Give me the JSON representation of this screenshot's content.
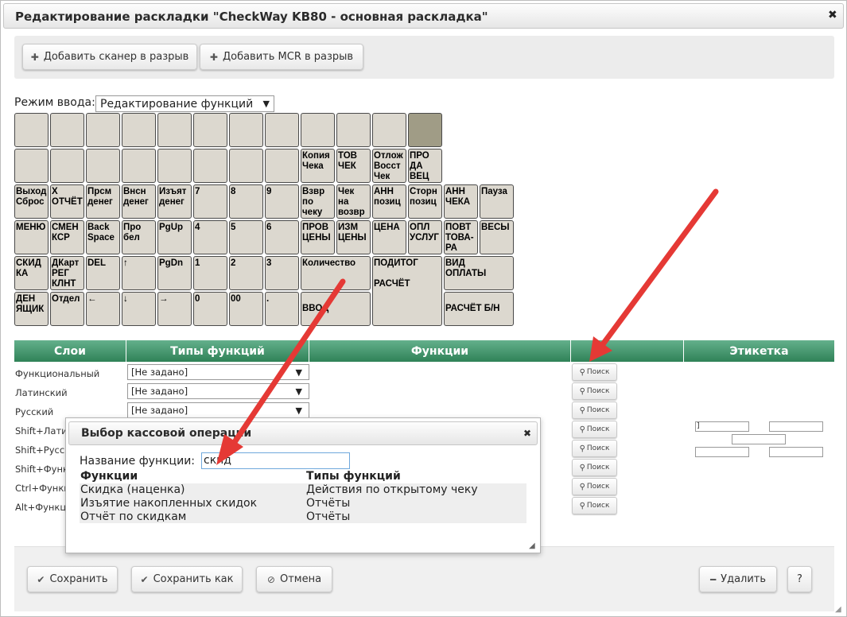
{
  "window": {
    "title": "Редактирование раскладки \"CheckWay KB80 - основная раскладка\""
  },
  "toolbar": {
    "add_scanner": "Добавить сканер в разрыв",
    "add_mcr": "Добавить MCR в разрыв"
  },
  "mode": {
    "label": "Режим ввода:",
    "value": "Редактирование функций"
  },
  "keyboard": {
    "keys": [
      "",
      "",
      "",
      "",
      "",
      "",
      "",
      "",
      "",
      "",
      "",
      "",
      "",
      "",
      "",
      "",
      "",
      "",
      "",
      "",
      "Копия\nЧека",
      "ТОВ\nЧЕК",
      "Отлож\nВосст\nЧек",
      "ПРО\nДА\nВЕЦ",
      "Выход\nСброс",
      "X\nОТЧЁТ",
      "Прсм\nденег",
      "Внсн\nденег",
      "Изъят\nденег",
      "7",
      "8",
      "9",
      "Взвр\nпо\nчеку",
      "Чек\nна\nвозвр",
      "АНН\nпозиц",
      "Сторн\nпозиц",
      "АНН\nЧЕКА",
      "Пауза",
      "МЕНЮ",
      "СМЕН\nКСР",
      "Back\nSpace",
      "Про\nбел",
      "PgUp",
      "4",
      "5",
      "6",
      "ПРОВ\nЦЕНЫ",
      "ИЗМ\nЦЕНЫ",
      "ЦЕНА",
      "ОПЛ\nУСЛУГ",
      "ПОВТ\nТОВА-\nРА",
      "ВЕСЫ",
      "СКИД\nКА",
      "ДКарт\nРЕГ\nКЛНТ",
      "DEL",
      "↑",
      "PgDn",
      "1",
      "2",
      "3",
      "Количество",
      "ПОДИТОГ\n\nРАСЧЁТ",
      "ВИД\nОПЛАТЫ",
      "ДЕН\nЯЩИК",
      "Отдел",
      "←",
      "↓",
      "→",
      "0",
      "00",
      ".",
      "ВВОД",
      "РАСЧЁТ Б/Н"
    ]
  },
  "table": {
    "headers": [
      "Слои",
      "Типы функций",
      "Функции",
      "",
      "Этикетка"
    ],
    "rows": [
      {
        "layer": "Функциональный",
        "type": "[Не задано]"
      },
      {
        "layer": "Латинский",
        "type": "[Не задано]"
      },
      {
        "layer": "Русский",
        "type": "[Не задано]"
      },
      {
        "layer": "Shift+Лати"
      },
      {
        "layer": "Shift+Русс"
      },
      {
        "layer": "Shift+Функ"
      },
      {
        "layer": "Ctrl+Функц"
      },
      {
        "layer": "Alt+Функц"
      }
    ],
    "search_label": "Поиск",
    "label_fields": [
      "]",
      "",
      "",
      "",
      ""
    ]
  },
  "dialog": {
    "title": "Выбор кассовой операции",
    "name_label": "Название функции:",
    "name_value": "скид",
    "col_functions": "Функции",
    "col_types": "Типы функций",
    "results": [
      {
        "function": "Скидка (наценка)",
        "type": "Действия по открытому чеку"
      },
      {
        "function": "Изъятие накопленных скидок",
        "type": "Отчёты"
      },
      {
        "function": "Отчёт по скидкам",
        "type": "Отчёты"
      }
    ]
  },
  "footer": {
    "save": "Сохранить",
    "save_as": "Сохранить как",
    "cancel": "Отмена",
    "delete": "Удалить",
    "help": "?"
  },
  "icons": {
    "close": "close-icon",
    "plus": "plus-icon",
    "search": "search-icon",
    "check": "check-icon",
    "cancel": "cancel-icon",
    "minus": "minus-icon"
  },
  "colors": {
    "header_green": "#2f8257",
    "key_bg": "#dcd8cf",
    "key_dark": "#a09c86",
    "annotation_arrow": "#e53935"
  }
}
